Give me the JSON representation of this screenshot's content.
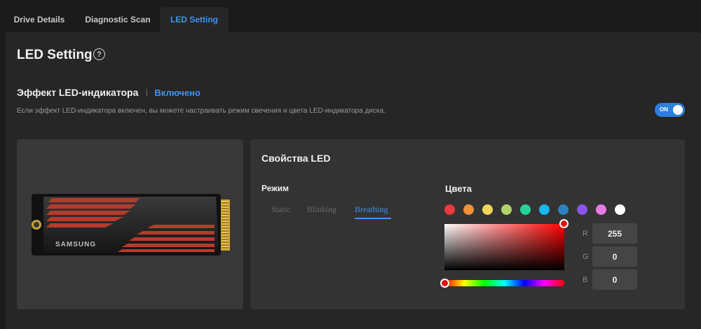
{
  "tabs": [
    {
      "label": "Drive Details"
    },
    {
      "label": "Diagnostic Scan"
    },
    {
      "label": "LED Setting"
    }
  ],
  "page": {
    "title": "LED Setting",
    "help_glyph": "?"
  },
  "led_effect": {
    "label": "Эффект LED-индикатора",
    "status": "Включено",
    "description": "Если эффект LED-индикатора включен, вы можете настраивать режим свечения и цвета LED-индикатора диска.",
    "toggle_text": "ON"
  },
  "product_image": {
    "brand": "SAMSUNG"
  },
  "properties": {
    "title": "Свойства LED",
    "mode_title": "Режим",
    "modes": [
      {
        "label": "Static"
      },
      {
        "label": "Blinking"
      },
      {
        "label": "Breathing"
      }
    ],
    "selected_mode": "Breathing",
    "colors_title": "Цвета",
    "swatches": [
      {
        "color": "#e83b3b"
      },
      {
        "color": "#f0913a"
      },
      {
        "color": "#f2d45a"
      },
      {
        "color": "#b2d36a"
      },
      {
        "color": "#28d39a"
      },
      {
        "color": "#18b8f0"
      },
      {
        "color": "#2a83c0"
      },
      {
        "color": "#8a55e8"
      },
      {
        "color": "#e87ae6"
      },
      {
        "color": "#ffffff"
      }
    ],
    "rgb": {
      "r_label": "R",
      "r_value": "255",
      "g_label": "G",
      "g_value": "0",
      "b_label": "B",
      "b_value": "0"
    }
  },
  "accent_color": "#3d94f5"
}
